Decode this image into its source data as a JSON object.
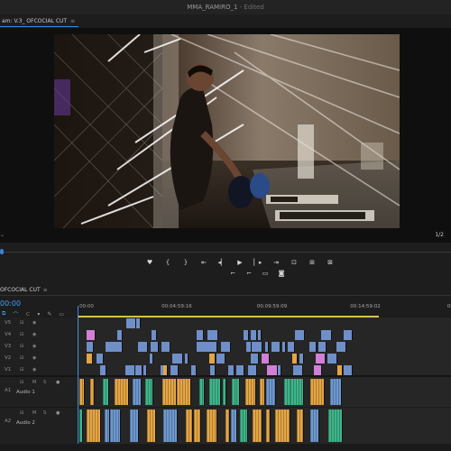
{
  "app": {
    "project_title": "MMA_RAMIRO_1",
    "edited_label": " - Edited"
  },
  "program_monitor": {
    "tab_label": "am: V.3_ OFCOCIAL CUT",
    "menu_glyph": "≡",
    "zoom_glyph": "⌄",
    "resolution": "1/2"
  },
  "transport": {
    "row1": [
      {
        "name": "marker-icon",
        "glyph": "♥"
      },
      {
        "name": "in-point-icon",
        "glyph": "{"
      },
      {
        "name": "out-point-icon",
        "glyph": "}"
      },
      {
        "name": "go-to-in-icon",
        "glyph": "⇤"
      },
      {
        "name": "step-back-icon",
        "glyph": "◂▏"
      },
      {
        "name": "play-icon",
        "glyph": "▶"
      },
      {
        "name": "step-forward-icon",
        "glyph": "▏▸"
      },
      {
        "name": "go-to-out-icon",
        "glyph": "⇥"
      },
      {
        "name": "insert-icon",
        "glyph": "⊡"
      },
      {
        "name": "overwrite-icon",
        "glyph": "⊞"
      },
      {
        "name": "export-frame-icon",
        "glyph": "⊠"
      }
    ],
    "row2": [
      {
        "name": "lift-icon",
        "glyph": "⌐"
      },
      {
        "name": "extract-icon",
        "glyph": "⌐"
      },
      {
        "name": "compare-icon",
        "glyph": "▭"
      },
      {
        "name": "camera-icon",
        "glyph": "◙"
      }
    ]
  },
  "timeline": {
    "sequence_tab": "OFCOCIAL CUT",
    "menu_glyph": "≡",
    "timecode": "00:00",
    "ruler_labels": [
      {
        "text": "00:00",
        "pos": 0.005
      },
      {
        "text": "00:04:59:16",
        "pos": 0.225
      },
      {
        "text": "00:09:59:09",
        "pos": 0.48
      },
      {
        "text": "00:14:59:02",
        "pos": 0.73
      },
      {
        "text": "00",
        "pos": 0.99
      }
    ],
    "tracks": [
      {
        "id": "V5",
        "name": "V5",
        "type": "video"
      },
      {
        "id": "V4",
        "name": "V4",
        "type": "video"
      },
      {
        "id": "V3",
        "name": "V3",
        "type": "video"
      },
      {
        "id": "V2",
        "name": "V2",
        "type": "video"
      },
      {
        "id": "V1",
        "name": "V1",
        "type": "video"
      },
      {
        "id": "A1",
        "name": "A1",
        "label": "Audio 1",
        "type": "audio"
      },
      {
        "id": "A2",
        "name": "A2",
        "label": "Audio 2",
        "type": "audio"
      }
    ],
    "colors": {
      "video": "#6f8fc9",
      "pink": "#d27fd8",
      "orange": "#e4a544",
      "green": "#3fb48a",
      "audio_blue": "#6e98cf",
      "red": "#c03a3a",
      "playhead": "#3a8fe8",
      "workarea": "#d8c24a"
    }
  }
}
